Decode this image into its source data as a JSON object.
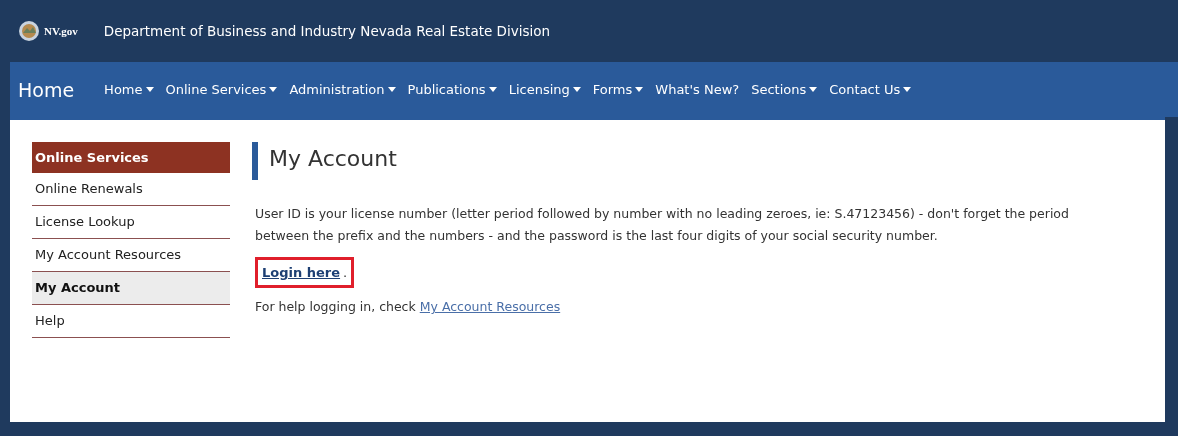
{
  "header": {
    "logo_text": "NV.gov",
    "title": "Department of Business and Industry Nevada Real Estate Division"
  },
  "nav": {
    "brand": "Home",
    "items": [
      {
        "label": "Home",
        "has_menu": true
      },
      {
        "label": "Online Services",
        "has_menu": true
      },
      {
        "label": "Administration",
        "has_menu": true
      },
      {
        "label": "Publications",
        "has_menu": true
      },
      {
        "label": "Licensing",
        "has_menu": true
      },
      {
        "label": "Forms",
        "has_menu": true
      },
      {
        "label": "What's New?",
        "has_menu": false
      },
      {
        "label": "Sections",
        "has_menu": true
      },
      {
        "label": "Contact Us",
        "has_menu": true
      }
    ]
  },
  "sidebar": {
    "heading": "Online Services",
    "items": [
      {
        "label": "Online Renewals",
        "selected": false
      },
      {
        "label": "License Lookup",
        "selected": false
      },
      {
        "label": "My Account Resources",
        "selected": false
      },
      {
        "label": "My Account",
        "selected": true
      },
      {
        "label": "Help",
        "selected": false
      }
    ]
  },
  "main": {
    "title": "My Account",
    "intro": "User ID is your license number (letter period followed by number with no leading zeroes, ie: S.47123456) - don't forget the period between the prefix and the numbers - and the password is the last four digits of your social security number.",
    "login_link": "Login here",
    "login_suffix": ".",
    "help_text": "For help logging in, check",
    "help_link": "My Account Resources"
  }
}
